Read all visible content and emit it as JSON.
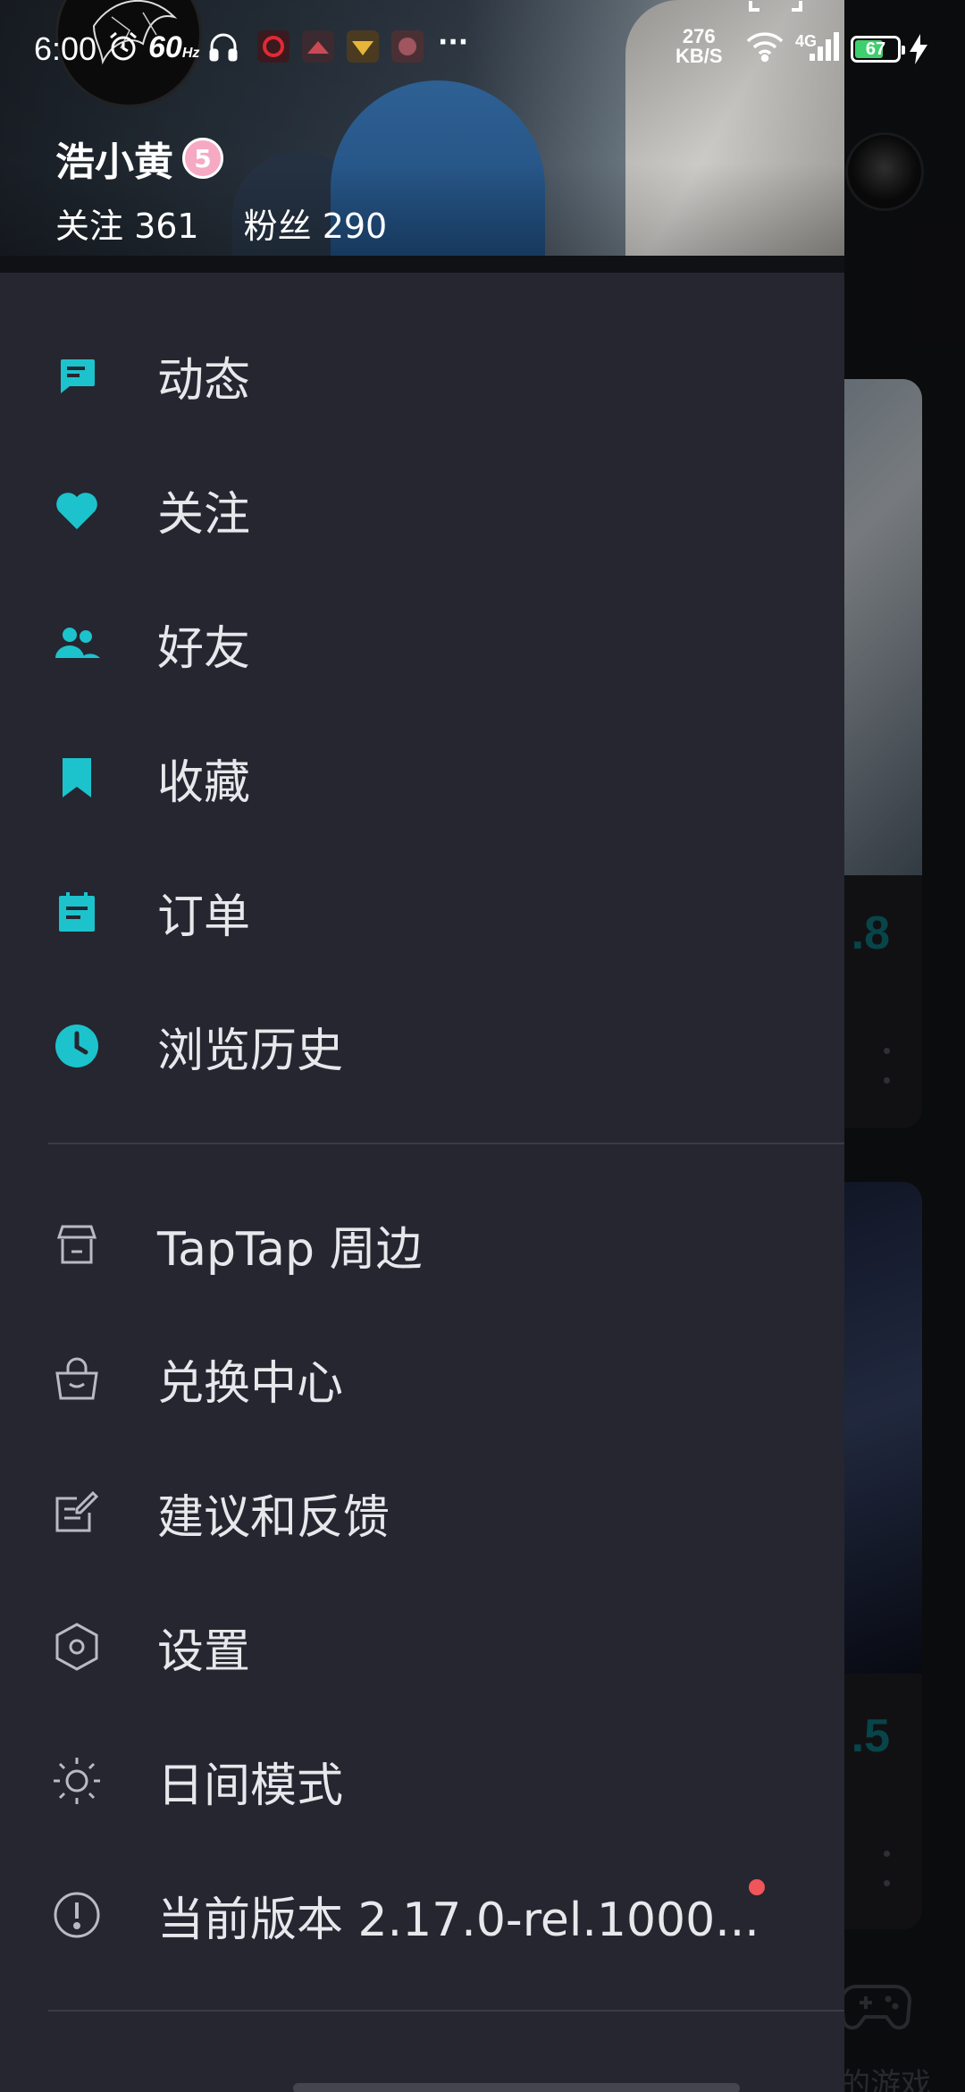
{
  "status_bar": {
    "time": "6:00",
    "refresh_rate": "60",
    "refresh_unit": "Hz",
    "more": "···",
    "net_speed_value": "276",
    "net_speed_unit": "KB/S",
    "network_type": "4G",
    "battery_level": "67"
  },
  "profile": {
    "username": "浩小黄",
    "level_badge": "5",
    "following_label": "关注 361",
    "followers_label": "粉丝 290"
  },
  "menu_primary": [
    {
      "label": "动态",
      "icon": "feed-icon"
    },
    {
      "label": "关注",
      "icon": "heart-icon"
    },
    {
      "label": "好友",
      "icon": "friends-icon"
    },
    {
      "label": "收藏",
      "icon": "bookmark-icon"
    },
    {
      "label": "订单",
      "icon": "order-icon"
    },
    {
      "label": "浏览历史",
      "icon": "history-icon"
    }
  ],
  "menu_secondary": [
    {
      "label": "TapTap 周边",
      "icon": "store-icon"
    },
    {
      "label": "兑换中心",
      "icon": "shopping-bag-icon"
    },
    {
      "label": "建议和反馈",
      "icon": "feedback-icon"
    },
    {
      "label": "设置",
      "icon": "settings-icon"
    },
    {
      "label": "日间模式",
      "icon": "sun-icon"
    },
    {
      "label": "当前版本 2.17.0-rel.1000...",
      "icon": "info-icon"
    }
  ],
  "background": {
    "card1_score": ".8",
    "card2_score": ".5",
    "bottom_nav_label": "的游戏"
  },
  "colors": {
    "accent": "#1cc3cc",
    "drawer_bg": "#252630",
    "notification_dot": "#f0555a"
  }
}
